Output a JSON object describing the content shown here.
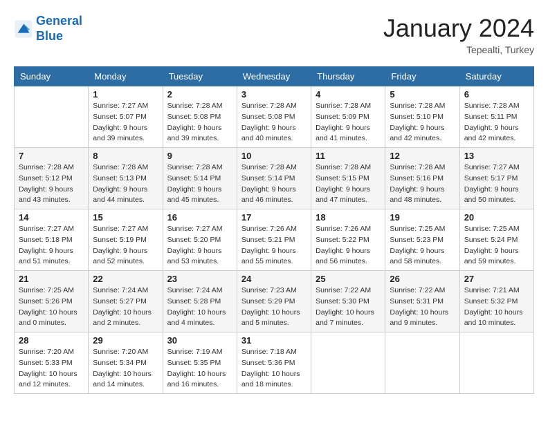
{
  "logo": {
    "line1": "General",
    "line2": "Blue"
  },
  "title": "January 2024",
  "location": "Tepealti, Turkey",
  "headers": [
    "Sunday",
    "Monday",
    "Tuesday",
    "Wednesday",
    "Thursday",
    "Friday",
    "Saturday"
  ],
  "weeks": [
    [
      {
        "day": "",
        "sunrise": "",
        "sunset": "",
        "daylight": ""
      },
      {
        "day": "1",
        "sunrise": "Sunrise: 7:27 AM",
        "sunset": "Sunset: 5:07 PM",
        "daylight": "Daylight: 9 hours and 39 minutes."
      },
      {
        "day": "2",
        "sunrise": "Sunrise: 7:28 AM",
        "sunset": "Sunset: 5:08 PM",
        "daylight": "Daylight: 9 hours and 39 minutes."
      },
      {
        "day": "3",
        "sunrise": "Sunrise: 7:28 AM",
        "sunset": "Sunset: 5:08 PM",
        "daylight": "Daylight: 9 hours and 40 minutes."
      },
      {
        "day": "4",
        "sunrise": "Sunrise: 7:28 AM",
        "sunset": "Sunset: 5:09 PM",
        "daylight": "Daylight: 9 hours and 41 minutes."
      },
      {
        "day": "5",
        "sunrise": "Sunrise: 7:28 AM",
        "sunset": "Sunset: 5:10 PM",
        "daylight": "Daylight: 9 hours and 42 minutes."
      },
      {
        "day": "6",
        "sunrise": "Sunrise: 7:28 AM",
        "sunset": "Sunset: 5:11 PM",
        "daylight": "Daylight: 9 hours and 42 minutes."
      }
    ],
    [
      {
        "day": "7",
        "sunrise": "Sunrise: 7:28 AM",
        "sunset": "Sunset: 5:12 PM",
        "daylight": "Daylight: 9 hours and 43 minutes."
      },
      {
        "day": "8",
        "sunrise": "Sunrise: 7:28 AM",
        "sunset": "Sunset: 5:13 PM",
        "daylight": "Daylight: 9 hours and 44 minutes."
      },
      {
        "day": "9",
        "sunrise": "Sunrise: 7:28 AM",
        "sunset": "Sunset: 5:14 PM",
        "daylight": "Daylight: 9 hours and 45 minutes."
      },
      {
        "day": "10",
        "sunrise": "Sunrise: 7:28 AM",
        "sunset": "Sunset: 5:14 PM",
        "daylight": "Daylight: 9 hours and 46 minutes."
      },
      {
        "day": "11",
        "sunrise": "Sunrise: 7:28 AM",
        "sunset": "Sunset: 5:15 PM",
        "daylight": "Daylight: 9 hours and 47 minutes."
      },
      {
        "day": "12",
        "sunrise": "Sunrise: 7:28 AM",
        "sunset": "Sunset: 5:16 PM",
        "daylight": "Daylight: 9 hours and 48 minutes."
      },
      {
        "day": "13",
        "sunrise": "Sunrise: 7:27 AM",
        "sunset": "Sunset: 5:17 PM",
        "daylight": "Daylight: 9 hours and 50 minutes."
      }
    ],
    [
      {
        "day": "14",
        "sunrise": "Sunrise: 7:27 AM",
        "sunset": "Sunset: 5:18 PM",
        "daylight": "Daylight: 9 hours and 51 minutes."
      },
      {
        "day": "15",
        "sunrise": "Sunrise: 7:27 AM",
        "sunset": "Sunset: 5:19 PM",
        "daylight": "Daylight: 9 hours and 52 minutes."
      },
      {
        "day": "16",
        "sunrise": "Sunrise: 7:27 AM",
        "sunset": "Sunset: 5:20 PM",
        "daylight": "Daylight: 9 hours and 53 minutes."
      },
      {
        "day": "17",
        "sunrise": "Sunrise: 7:26 AM",
        "sunset": "Sunset: 5:21 PM",
        "daylight": "Daylight: 9 hours and 55 minutes."
      },
      {
        "day": "18",
        "sunrise": "Sunrise: 7:26 AM",
        "sunset": "Sunset: 5:22 PM",
        "daylight": "Daylight: 9 hours and 56 minutes."
      },
      {
        "day": "19",
        "sunrise": "Sunrise: 7:25 AM",
        "sunset": "Sunset: 5:23 PM",
        "daylight": "Daylight: 9 hours and 58 minutes."
      },
      {
        "day": "20",
        "sunrise": "Sunrise: 7:25 AM",
        "sunset": "Sunset: 5:24 PM",
        "daylight": "Daylight: 9 hours and 59 minutes."
      }
    ],
    [
      {
        "day": "21",
        "sunrise": "Sunrise: 7:25 AM",
        "sunset": "Sunset: 5:26 PM",
        "daylight": "Daylight: 10 hours and 0 minutes."
      },
      {
        "day": "22",
        "sunrise": "Sunrise: 7:24 AM",
        "sunset": "Sunset: 5:27 PM",
        "daylight": "Daylight: 10 hours and 2 minutes."
      },
      {
        "day": "23",
        "sunrise": "Sunrise: 7:24 AM",
        "sunset": "Sunset: 5:28 PM",
        "daylight": "Daylight: 10 hours and 4 minutes."
      },
      {
        "day": "24",
        "sunrise": "Sunrise: 7:23 AM",
        "sunset": "Sunset: 5:29 PM",
        "daylight": "Daylight: 10 hours and 5 minutes."
      },
      {
        "day": "25",
        "sunrise": "Sunrise: 7:22 AM",
        "sunset": "Sunset: 5:30 PM",
        "daylight": "Daylight: 10 hours and 7 minutes."
      },
      {
        "day": "26",
        "sunrise": "Sunrise: 7:22 AM",
        "sunset": "Sunset: 5:31 PM",
        "daylight": "Daylight: 10 hours and 9 minutes."
      },
      {
        "day": "27",
        "sunrise": "Sunrise: 7:21 AM",
        "sunset": "Sunset: 5:32 PM",
        "daylight": "Daylight: 10 hours and 10 minutes."
      }
    ],
    [
      {
        "day": "28",
        "sunrise": "Sunrise: 7:20 AM",
        "sunset": "Sunset: 5:33 PM",
        "daylight": "Daylight: 10 hours and 12 minutes."
      },
      {
        "day": "29",
        "sunrise": "Sunrise: 7:20 AM",
        "sunset": "Sunset: 5:34 PM",
        "daylight": "Daylight: 10 hours and 14 minutes."
      },
      {
        "day": "30",
        "sunrise": "Sunrise: 7:19 AM",
        "sunset": "Sunset: 5:35 PM",
        "daylight": "Daylight: 10 hours and 16 minutes."
      },
      {
        "day": "31",
        "sunrise": "Sunrise: 7:18 AM",
        "sunset": "Sunset: 5:36 PM",
        "daylight": "Daylight: 10 hours and 18 minutes."
      },
      {
        "day": "",
        "sunrise": "",
        "sunset": "",
        "daylight": ""
      },
      {
        "day": "",
        "sunrise": "",
        "sunset": "",
        "daylight": ""
      },
      {
        "day": "",
        "sunrise": "",
        "sunset": "",
        "daylight": ""
      }
    ]
  ]
}
